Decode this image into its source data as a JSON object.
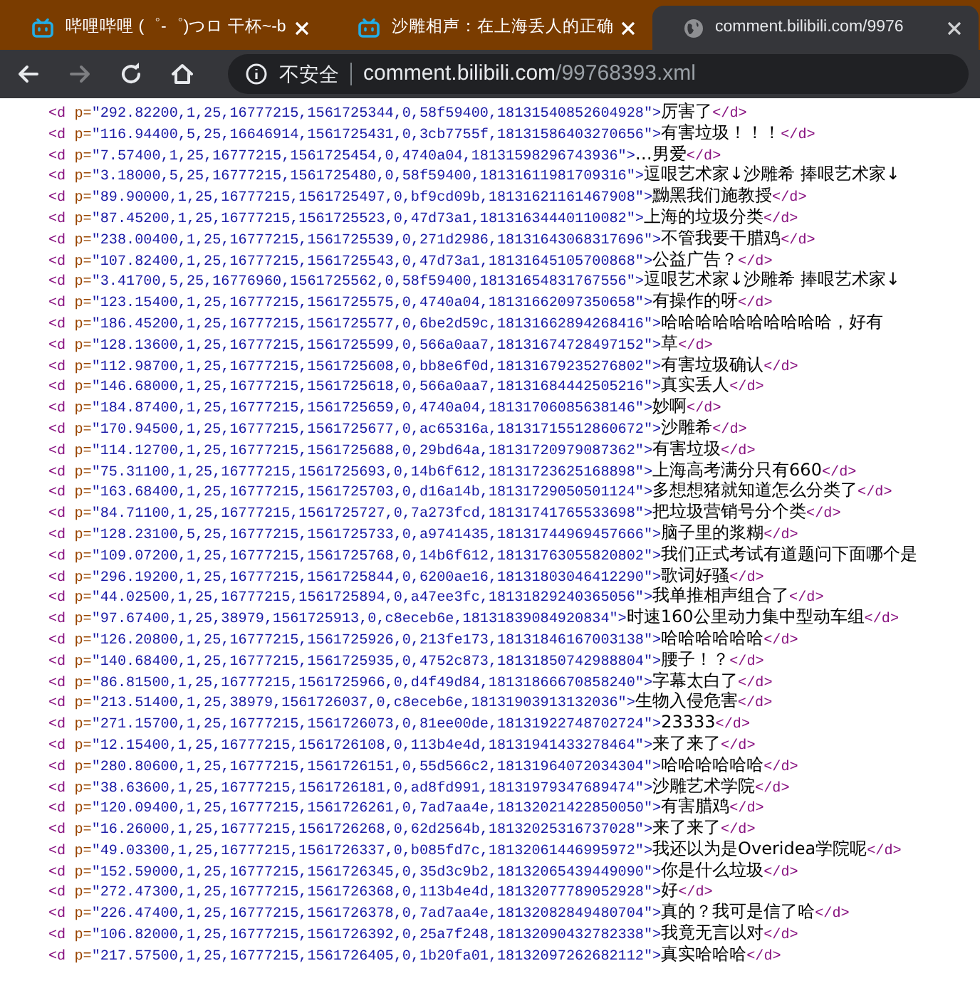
{
  "tabs": [
    {
      "kind": "bilibili",
      "title": "哔哩哔哩 (゜-゜)つロ 干杯~-b",
      "selected": false
    },
    {
      "kind": "bilibili",
      "title": "沙雕相声：在上海丢人的正确",
      "selected": false
    },
    {
      "kind": "globe",
      "title": "comment.bilibili.com/9976",
      "selected": true
    }
  ],
  "toolbar": [
    {
      "kind": "back",
      "disabled": false
    },
    {
      "kind": "forward",
      "disabled": true
    },
    {
      "kind": "reload",
      "disabled": false
    },
    {
      "kind": "home",
      "disabled": false
    }
  ],
  "address": {
    "security": "不安全",
    "host": "comment.bilibili.com",
    "path": "/99768393.xml"
  },
  "lines": [
    {
      "open": "<d",
      "attr": "p=",
      "value": "\"292.82200,1,25,16777215,1561725344,0,58f59400,18131540852604928\">",
      "text": "厉害了",
      "close": "</d>"
    },
    {
      "open": "<d",
      "attr": "p=",
      "value": "\"116.94400,5,25,16646914,1561725431,0,3cb7755f,18131586403270656\">",
      "text": "有害垃圾！！！",
      "close": "</d>"
    },
    {
      "open": "<d",
      "attr": "p=",
      "value": "\"7.57400,1,25,16777215,1561725454,0,4740a04,18131598296743936\">",
      "text": "…男爱",
      "close": "</d>"
    },
    {
      "open": "<d",
      "attr": "p=",
      "value": "\"3.18000,5,25,16777215,1561725480,0,58f59400,18131611981709316\">",
      "text": "逗哏艺术家↓沙雕希 捧哏艺术家↓"
    },
    {
      "open": "<d",
      "attr": "p=",
      "value": "\"89.90000,1,25,16777215,1561725497,0,bf9cd09b,18131621161467908\">",
      "text": "黝黑我们施教授",
      "close": "</d>"
    },
    {
      "open": "<d",
      "attr": "p=",
      "value": "\"87.45200,1,25,16777215,1561725523,0,47d73a1,18131634440110082\">",
      "text": "上海的垃圾分类",
      "close": "</d>"
    },
    {
      "open": "<d",
      "attr": "p=",
      "value": "\"238.00400,1,25,16777215,1561725539,0,271d2986,18131643068317696\">",
      "text": "不管我要干腊鸡",
      "close": "</d>"
    },
    {
      "open": "<d",
      "attr": "p=",
      "value": "\"107.82400,1,25,16777215,1561725543,0,47d73a1,18131645105700868\">",
      "text": "公益广告？",
      "close": "</d>"
    },
    {
      "open": "<d",
      "attr": "p=",
      "value": "\"3.41700,5,25,16776960,1561725562,0,58f59400,18131654831767556\">",
      "text": "逗哏艺术家↓沙雕希 捧哏艺术家↓"
    },
    {
      "open": "<d",
      "attr": "p=",
      "value": "\"123.15400,1,25,16777215,1561725575,0,4740a04,18131662097350658\">",
      "text": "有操作的呀",
      "close": "</d>"
    },
    {
      "open": "<d",
      "attr": "p=",
      "value": "\"186.45200,1,25,16777215,1561725577,0,6be2d59c,18131662894268416\">",
      "text": "哈哈哈哈哈哈哈哈哈哈，好有"
    },
    {
      "open": "<d",
      "attr": "p=",
      "value": "\"128.13600,1,25,16777215,1561725599,0,566a0aa7,18131674728497152\">",
      "text": "草",
      "close": "</d>"
    },
    {
      "open": "<d",
      "attr": "p=",
      "value": "\"112.98700,1,25,16777215,1561725608,0,bb8e6f0d,18131679235276802\">",
      "text": "有害垃圾确认",
      "close": "</d>"
    },
    {
      "open": "<d",
      "attr": "p=",
      "value": "\"146.68000,1,25,16777215,1561725618,0,566a0aa7,18131684442505216\">",
      "text": "真实丢人",
      "close": "</d>"
    },
    {
      "open": "<d",
      "attr": "p=",
      "value": "\"184.87400,1,25,16777215,1561725659,0,4740a04,18131706085638146\">",
      "text": "妙啊",
      "close": "</d>"
    },
    {
      "open": "<d",
      "attr": "p=",
      "value": "\"170.94500,1,25,16777215,1561725677,0,ac65316a,18131715512860672\">",
      "text": "沙雕希",
      "close": "</d>"
    },
    {
      "open": "<d",
      "attr": "p=",
      "value": "\"114.12700,1,25,16777215,1561725688,0,29bd64a,18131720979087362\">",
      "text": "有害垃圾",
      "close": "</d>"
    },
    {
      "open": "<d",
      "attr": "p=",
      "value": "\"75.31100,1,25,16777215,1561725693,0,14b6f612,18131723625168898\">",
      "text": "上海高考满分只有660",
      "close": "</d>"
    },
    {
      "open": "<d",
      "attr": "p=",
      "value": "\"163.68400,1,25,16777215,1561725703,0,d16a14b,18131729050501124\">",
      "text": "多想想猪就知道怎么分类了",
      "close": "</d>"
    },
    {
      "open": "<d",
      "attr": "p=",
      "value": "\"84.71100,1,25,16777215,1561725727,0,7a273fcd,18131741765533698\">",
      "text": "把垃圾营销号分个类",
      "close": "</d>"
    },
    {
      "open": "<d",
      "attr": "p=",
      "value": "\"128.23100,5,25,16777215,1561725733,0,a9741435,18131744969457666\">",
      "text": "脑子里的浆糊",
      "close": "</d>"
    },
    {
      "open": "<d",
      "attr": "p=",
      "value": "\"109.07200,1,25,16777215,1561725768,0,14b6f612,18131763055820802\">",
      "text": "我们正式考试有道题问下面哪个是"
    },
    {
      "open": "<d",
      "attr": "p=",
      "value": "\"296.19200,1,25,16777215,1561725844,0,6200ae16,18131803046412290\">",
      "text": "歌词好骚",
      "close": "</d>"
    },
    {
      "open": "<d",
      "attr": "p=",
      "value": "\"44.02500,1,25,16777215,1561725894,0,a47ee3fc,18131829240365056\">",
      "text": "我单推相声组合了",
      "close": "</d>"
    },
    {
      "open": "<d",
      "attr": "p=",
      "value": "\"97.67400,1,25,38979,1561725913,0,c8eceb6e,18131839084920834\">",
      "text": "时速160公里动力集中型动车组",
      "close": "</d>"
    },
    {
      "open": "<d",
      "attr": "p=",
      "value": "\"126.20800,1,25,16777215,1561725926,0,213fe173,18131846167003138\">",
      "text": "哈哈哈哈哈哈",
      "close": "</d>"
    },
    {
      "open": "<d",
      "attr": "p=",
      "value": "\"140.68400,1,25,16777215,1561725935,0,4752c873,18131850742988804\">",
      "text": "腰子！？",
      "close": "</d>"
    },
    {
      "open": "<d",
      "attr": "p=",
      "value": "\"86.81500,1,25,16777215,1561725966,0,d4f49d84,18131866670858240\">",
      "text": "字幕太白了",
      "close": "</d>"
    },
    {
      "open": "<d",
      "attr": "p=",
      "value": "\"213.51400,1,25,38979,1561726037,0,c8eceb6e,18131903913132036\">",
      "text": "生物入侵危害",
      "close": "</d>"
    },
    {
      "open": "<d",
      "attr": "p=",
      "value": "\"271.15700,1,25,16777215,1561726073,0,81ee00de,18131922748702724\">",
      "text": "23333",
      "close": "</d>"
    },
    {
      "open": "<d",
      "attr": "p=",
      "value": "\"12.15400,1,25,16777215,1561726108,0,113b4e4d,18131941433278464\">",
      "text": "来了来了",
      "close": "</d>"
    },
    {
      "open": "<d",
      "attr": "p=",
      "value": "\"280.80600,1,25,16777215,1561726151,0,55d566c2,18131964072034304\">",
      "text": "哈哈哈哈哈哈",
      "close": "</d>"
    },
    {
      "open": "<d",
      "attr": "p=",
      "value": "\"38.63600,1,25,16777215,1561726181,0,ad8fd991,18131979347689474\">",
      "text": "沙雕艺术学院",
      "close": "</d>"
    },
    {
      "open": "<d",
      "attr": "p=",
      "value": "\"120.09400,1,25,16777215,1561726261,0,7ad7aa4e,18132021422850050\">",
      "text": "有害腊鸡",
      "close": "</d>"
    },
    {
      "open": "<d",
      "attr": "p=",
      "value": "\"16.26000,1,25,16777215,1561726268,0,62d2564b,18132025316737028\">",
      "text": "来了来了",
      "close": "</d>"
    },
    {
      "open": "<d",
      "attr": "p=",
      "value": "\"49.03300,1,25,16777215,1561726337,0,b085fd7c,18132061446995972\">",
      "text": "我还以为是Overidea学院呢",
      "close": "</d>"
    },
    {
      "open": "<d",
      "attr": "p=",
      "value": "\"152.59000,1,25,16777215,1561726345,0,35d3c9b2,18132065439449090\">",
      "text": "你是什么垃圾",
      "close": "</d>"
    },
    {
      "open": "<d",
      "attr": "p=",
      "value": "\"272.47300,1,25,16777215,1561726368,0,113b4e4d,18132077789052928\">",
      "text": "好",
      "close": "</d>"
    },
    {
      "open": "<d",
      "attr": "p=",
      "value": "\"226.47400,1,25,16777215,1561726378,0,7ad7aa4e,18132082849480704\">",
      "text": "真的？我可是信了哈",
      "close": "</d>"
    },
    {
      "open": "<d",
      "attr": "p=",
      "value": "\"106.82000,1,25,16777215,1561726392,0,25a7f248,18132090432782338\">",
      "text": "我竟无言以对",
      "close": "</d>"
    },
    {
      "open": "<d",
      "attr": "p=",
      "value": "\"217.57500,1,25,16777215,1561726405,0,1b20fa01,18132097262682112\">",
      "text": "真实哈哈哈",
      "close": "</d>"
    }
  ]
}
